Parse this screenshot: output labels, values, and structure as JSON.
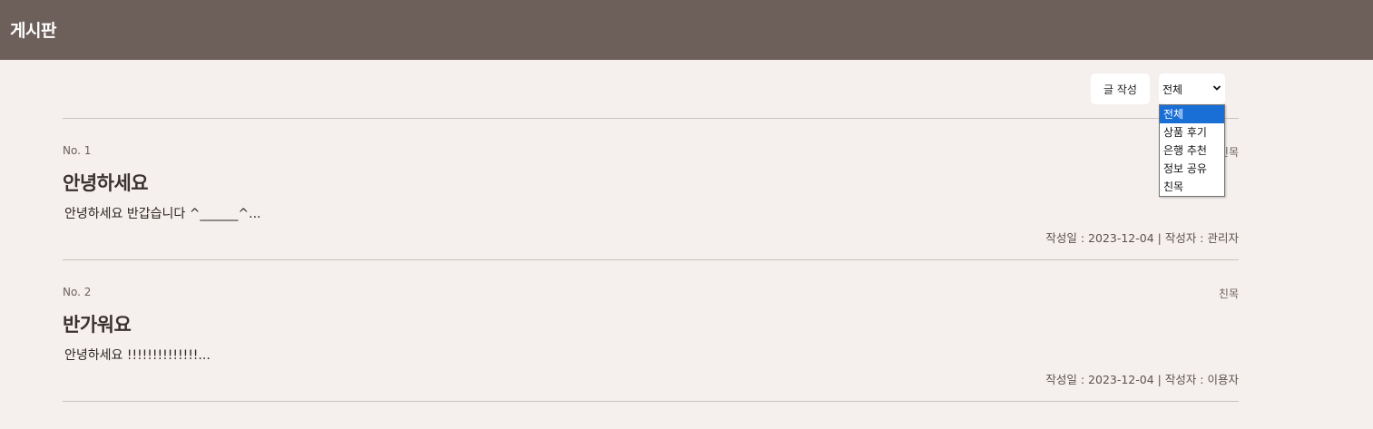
{
  "header": {
    "title": "게시판",
    "bg_color": "#6d605b"
  },
  "toolbar": {
    "write_label": "글 작성",
    "filter_selected": "전체",
    "filter_options": [
      "전체",
      "상품 후기",
      "은행 추천",
      "정보 공유",
      "친목"
    ],
    "highlight_color": "#1a6fd6"
  },
  "posts": [
    {
      "no": "No. 1",
      "category": "친목",
      "title": "안녕하세요",
      "body": "안녕하세요 반갑습니다 ^______^...",
      "meta": "작성일 : 2023-12-04 | 작성자 : 관리자"
    },
    {
      "no": "No. 2",
      "category": "친목",
      "title": "반가워요",
      "body": "안녕하세요 !!!!!!!!!!!!!!...",
      "meta": "작성일 : 2023-12-04 | 작성자 : 이용자"
    }
  ]
}
